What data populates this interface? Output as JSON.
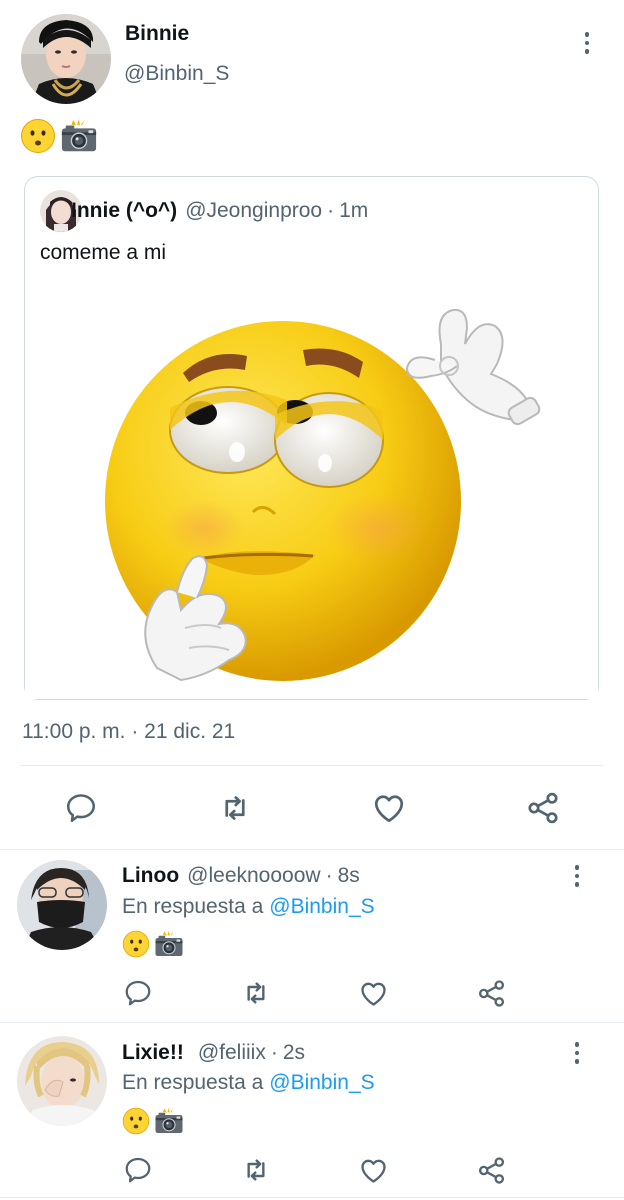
{
  "main_tweet": {
    "name": "Binnie",
    "handle": "@Binbin_S",
    "text_emojis": [
      "hushed-face-emoji",
      "camera-flash-emoji"
    ],
    "quote": {
      "name": "Innie (^o^)",
      "handle": "@Jeonginproo",
      "separator": "·",
      "time": "1m",
      "text": "comeme a mi",
      "media": "smirking-emoji-ok-hand-image"
    },
    "timestamp": "11:00 p. m. · 21 dic. 21"
  },
  "replies": [
    {
      "name": "Linoo",
      "handle": "@leeknoooow",
      "separator": "·",
      "time": "8s",
      "reply_prefix": "En respuesta a",
      "reply_to": "@Binbin_S",
      "text_emojis": [
        "hushed-face-emoji",
        "camera-flash-emoji"
      ]
    },
    {
      "name": "Lixie!!",
      "handle": "@feliiix",
      "separator": "·",
      "time": "2s",
      "reply_prefix": "En respuesta a",
      "reply_to": "@Binbin_S",
      "text_emojis": [
        "hushed-face-emoji",
        "camera-flash-emoji"
      ]
    }
  ],
  "actions": [
    "reply-icon",
    "retweet-icon",
    "like-icon",
    "share-icon"
  ],
  "colors": {
    "text_primary": "#0f1419",
    "text_secondary": "#536471",
    "link": "#1d9bf0",
    "border": "#cfd9de"
  }
}
